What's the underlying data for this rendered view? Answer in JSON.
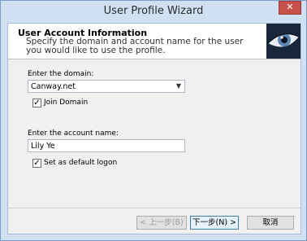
{
  "window": {
    "title": "User Profile Wizard"
  },
  "header": {
    "title": "User Account Information",
    "subtitle": "Specify the domain and account name for the user you would like to use the profile."
  },
  "form": {
    "domain_label": "Enter the domain:",
    "domain_value": "Canway.net",
    "join_domain_label": "Join Domain",
    "join_domain_checked": true,
    "account_label": "Enter the account name:",
    "account_value": "Lily Ye",
    "default_logon_label": "Set as default logon",
    "default_logon_checked": true
  },
  "buttons": {
    "back_label": "< 上一步(B)",
    "next_label": "下一步(N) >",
    "cancel_label": "取消"
  },
  "colors": {
    "title_bar": "#cfe0f3",
    "close_button": "#c7504a",
    "header_bg": "#ffffff",
    "dialog_bg": "#f0f0f0"
  },
  "icons": {
    "close": "close-icon",
    "dropdown": "chevron-down-icon",
    "check": "check-icon",
    "header_image": "eye-icon"
  }
}
